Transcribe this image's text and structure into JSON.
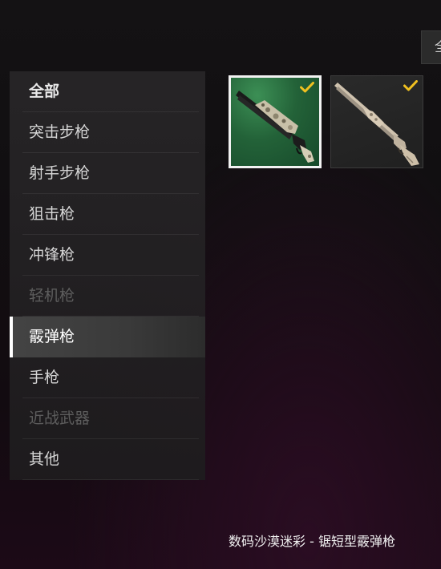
{
  "filter": {
    "label": "全"
  },
  "sidebar": {
    "items": [
      {
        "label": "全部",
        "state": "bold"
      },
      {
        "label": "突击步枪",
        "state": "normal"
      },
      {
        "label": "射手步枪",
        "state": "normal"
      },
      {
        "label": "狙击枪",
        "state": "normal"
      },
      {
        "label": "冲锋枪",
        "state": "normal"
      },
      {
        "label": "轻机枪",
        "state": "disabled"
      },
      {
        "label": "霰弹枪",
        "state": "selected"
      },
      {
        "label": "手枪",
        "state": "normal"
      },
      {
        "label": "近战武器",
        "state": "disabled"
      },
      {
        "label": "其他",
        "state": "normal"
      }
    ]
  },
  "skins": [
    {
      "icon": "sawed-off-shotgun-digital-desert-camo-icon",
      "owned": true,
      "selected": true
    },
    {
      "icon": "pump-shotgun-skin-icon",
      "owned": true,
      "selected": false
    }
  ],
  "selected_item": {
    "name": "数码沙漠迷彩 - 锯短型霰弹枪"
  },
  "colors": {
    "check": "#f0c020",
    "selected_border": "#f2f2f2",
    "card1_bg": "#236238",
    "sidebar_bg": "#282628"
  }
}
